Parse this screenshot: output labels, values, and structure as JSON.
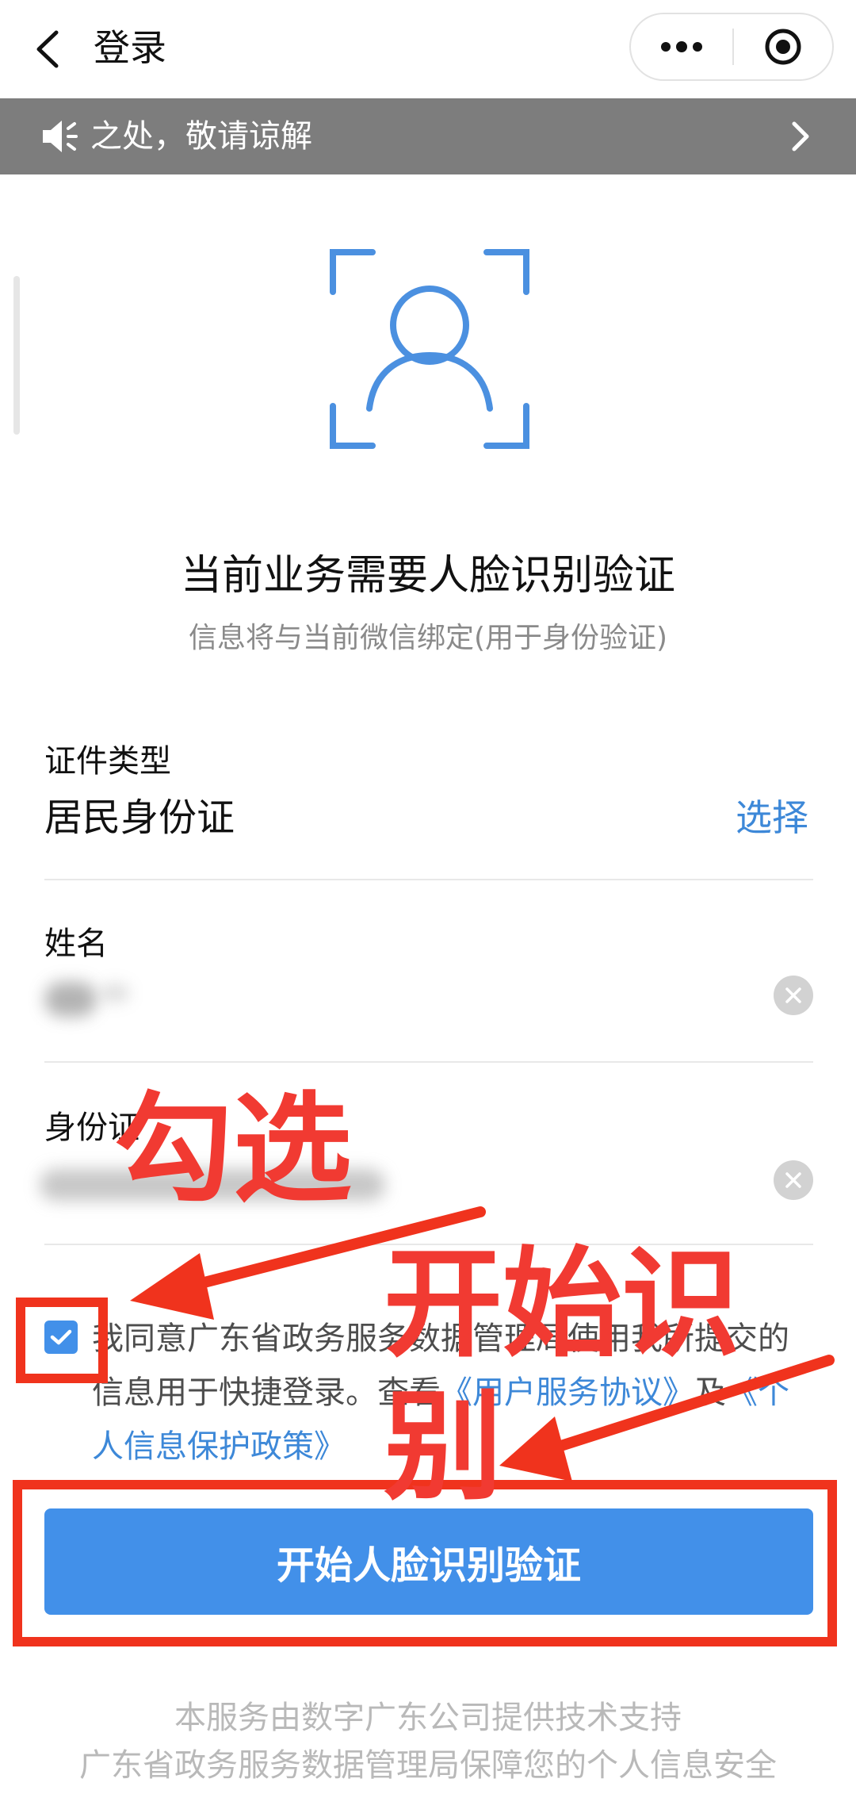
{
  "header": {
    "title": "登录"
  },
  "notice": {
    "text": "之处，敬请谅解"
  },
  "intro": {
    "heading": "当前业务需要人脸识别验证",
    "subheading": "信息将与当前微信绑定(用于身份验证)"
  },
  "form": {
    "id_type": {
      "label": "证件类型",
      "value": "居民身份证",
      "action": "选择"
    },
    "name": {
      "label": "姓名"
    },
    "id_number": {
      "label": "身份证"
    }
  },
  "agreement": {
    "checked": true,
    "text": "我同意广东省政务服务数据管理局使用我所提交的信息用于快捷登录。查看",
    "link_terms": "《用户服务协议》",
    "joiner": "及",
    "link_privacy": "《个人信息保护政策》"
  },
  "submit": {
    "label": "开始人脸识别验证"
  },
  "footer": {
    "line1": "本服务由数字广东公司提供技术支持",
    "line2": "广东省政务服务数据管理局保障您的个人信息安全"
  },
  "annotations": {
    "check_hint": "勾选",
    "start_hint": "开始识别"
  },
  "colors": {
    "primary": "#4290e9",
    "link": "#3d88d8",
    "notice_bg": "#7d7d7d",
    "annotation_red": "#f0331d"
  }
}
